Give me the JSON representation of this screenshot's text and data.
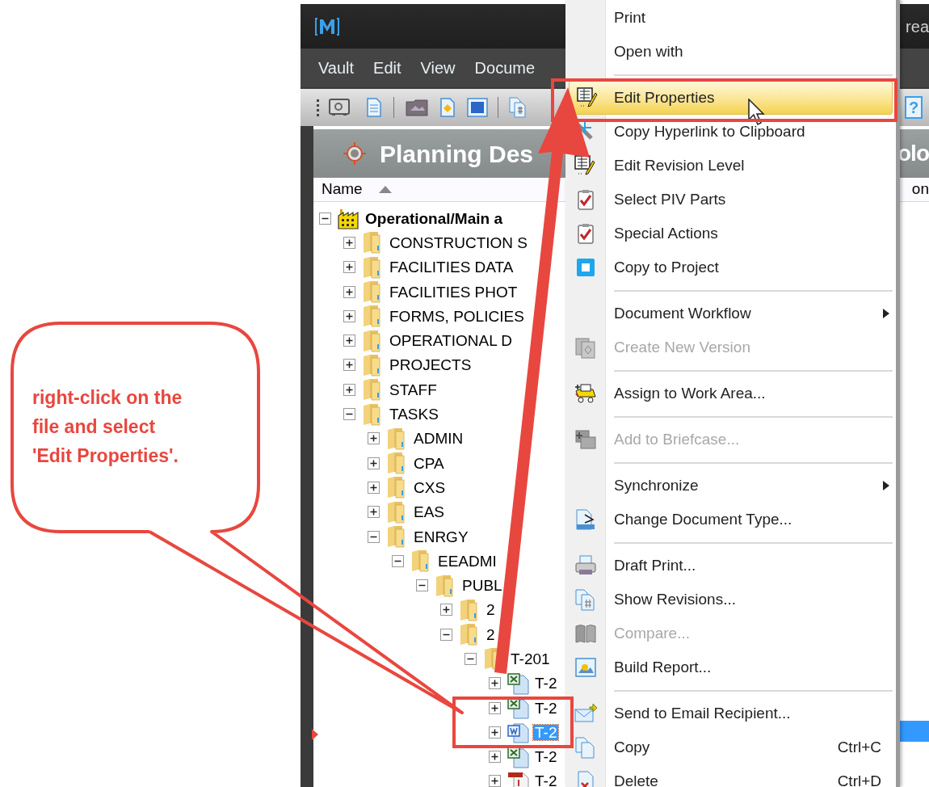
{
  "window": {
    "title_fragment": "rea"
  },
  "menu_bar": [
    {
      "label": "Vault"
    },
    {
      "label": "Edit"
    },
    {
      "label": "View"
    },
    {
      "label": "Docume"
    }
  ],
  "toolbar": {
    "help_label": "?"
  },
  "panel": {
    "title": "Planning Des",
    "title_fragment": "olo"
  },
  "columns": [
    {
      "label": "Name",
      "sorted_ascending": true
    },
    {
      "label": "on"
    }
  ],
  "tree": {
    "label": "Operational/Main a",
    "kind": "site",
    "expanded": true,
    "selected": false,
    "children": [
      {
        "label": "CONSTRUCTION S",
        "kind": "folder",
        "expanded": false,
        "selected": false
      },
      {
        "label": "FACILITIES DATA",
        "kind": "folder",
        "expanded": false,
        "selected": false
      },
      {
        "label": "FACILITIES PHOT",
        "kind": "folder",
        "expanded": false,
        "selected": false
      },
      {
        "label": "FORMS, POLICIES",
        "kind": "folder",
        "expanded": false,
        "selected": false
      },
      {
        "label": "OPERATIONAL D",
        "kind": "folder",
        "expanded": false,
        "selected": false
      },
      {
        "label": "PROJECTS",
        "kind": "folder",
        "expanded": false,
        "selected": false
      },
      {
        "label": "STAFF",
        "kind": "folder",
        "expanded": false,
        "selected": false
      },
      {
        "label": "TASKS",
        "kind": "folder",
        "expanded": true,
        "selected": false,
        "children": [
          {
            "label": "ADMIN",
            "kind": "folder",
            "expanded": false,
            "selected": false
          },
          {
            "label": "CPA",
            "kind": "folder",
            "expanded": false,
            "selected": false
          },
          {
            "label": "CXS",
            "kind": "folder",
            "expanded": false,
            "selected": false
          },
          {
            "label": "EAS",
            "kind": "folder",
            "expanded": false,
            "selected": false
          },
          {
            "label": "ENRGY",
            "kind": "folder",
            "expanded": true,
            "selected": false,
            "children": [
              {
                "label": "EEADMI",
                "kind": "folder",
                "expanded": true,
                "selected": false,
                "children": [
                  {
                    "label": "PUBL",
                    "kind": "folder",
                    "expanded": true,
                    "selected": false,
                    "children": [
                      {
                        "label": "2",
                        "kind": "folder",
                        "expanded": false,
                        "selected": false
                      },
                      {
                        "label": "2",
                        "kind": "folder",
                        "expanded": true,
                        "selected": false,
                        "children": [
                          {
                            "label": "T-201",
                            "kind": "folder",
                            "expanded": true,
                            "selected": false,
                            "children": [
                              {
                                "label": "T-2",
                                "kind": "excel",
                                "expanded": false,
                                "selected": false
                              },
                              {
                                "label": "T-2",
                                "kind": "excel",
                                "expanded": false,
                                "selected": false
                              },
                              {
                                "label": "T-2",
                                "kind": "word",
                                "expanded": false,
                                "selected": true
                              },
                              {
                                "label": "T-2",
                                "kind": "excel",
                                "expanded": false,
                                "selected": false
                              },
                              {
                                "label": "T-2",
                                "kind": "pdf",
                                "expanded": false,
                                "selected": false
                              }
                            ]
                          }
                        ]
                      }
                    ]
                  }
                ]
              }
            ]
          }
        ]
      }
    ]
  },
  "context_menu": {
    "items": [
      {
        "kind": "item",
        "label": "Print",
        "disabled": false,
        "selected": false
      },
      {
        "kind": "item",
        "label": "Open with",
        "disabled": false,
        "selected": false
      },
      {
        "kind": "separator"
      },
      {
        "kind": "item",
        "label": "Edit Properties",
        "disabled": false,
        "selected": true
      },
      {
        "kind": "item",
        "label": "Copy Hyperlink to Clipboard",
        "disabled": false,
        "selected": false
      },
      {
        "kind": "item",
        "label": "Edit Revision Level",
        "disabled": false,
        "selected": false
      },
      {
        "kind": "item",
        "label": "Select PIV Parts",
        "disabled": false,
        "selected": false
      },
      {
        "kind": "item",
        "label": "Special Actions",
        "disabled": false,
        "selected": false
      },
      {
        "kind": "item",
        "label": "Copy to Project",
        "disabled": false,
        "selected": false
      },
      {
        "kind": "separator"
      },
      {
        "kind": "item",
        "label": "Document Workflow",
        "disabled": false,
        "selected": false,
        "submenu": true
      },
      {
        "kind": "item",
        "label": "Create New Version",
        "disabled": true,
        "selected": false
      },
      {
        "kind": "separator"
      },
      {
        "kind": "item",
        "label": "Assign to Work Area...",
        "disabled": false,
        "selected": false
      },
      {
        "kind": "separator"
      },
      {
        "kind": "item",
        "label": "Add to Briefcase...",
        "disabled": true,
        "selected": false
      },
      {
        "kind": "separator"
      },
      {
        "kind": "item",
        "label": "Synchronize",
        "disabled": false,
        "selected": false,
        "submenu": true
      },
      {
        "kind": "item",
        "label": "Change Document Type...",
        "disabled": false,
        "selected": false
      },
      {
        "kind": "separator"
      },
      {
        "kind": "item",
        "label": "Draft Print...",
        "disabled": false,
        "selected": false
      },
      {
        "kind": "item",
        "label": "Show Revisions...",
        "disabled": false,
        "selected": false
      },
      {
        "kind": "item",
        "label": "Compare...",
        "disabled": true,
        "selected": false
      },
      {
        "kind": "item",
        "label": "Build Report...",
        "disabled": false,
        "selected": false
      },
      {
        "kind": "separator"
      },
      {
        "kind": "item",
        "label": "Send to Email Recipient...",
        "disabled": false,
        "selected": false
      },
      {
        "kind": "item",
        "label": "Copy",
        "disabled": false,
        "selected": false,
        "shortcut": "Ctrl+C"
      },
      {
        "kind": "item",
        "label": "Delete",
        "disabled": false,
        "selected": false,
        "shortcut": "Ctrl+D"
      }
    ]
  },
  "callout": {
    "text": "right-click on the file and select 'Edit Properties'."
  }
}
